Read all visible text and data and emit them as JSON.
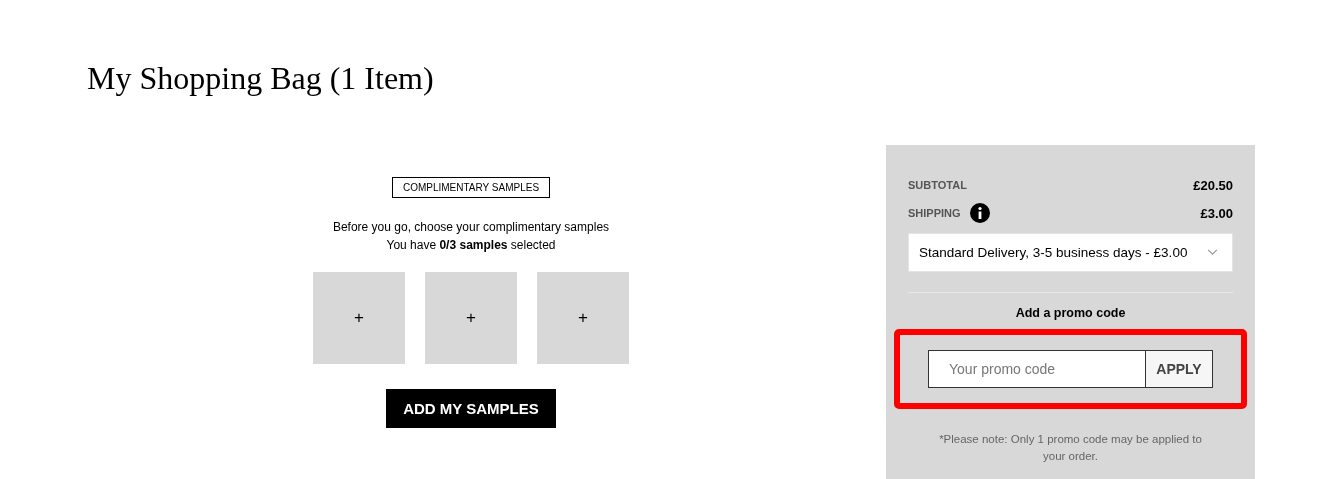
{
  "page_title": "My Shopping Bag (1 Item)",
  "samples": {
    "badge": "COMPLIMENTARY SAMPLES",
    "intro": "Before you go, choose your complimentary samples",
    "count_text": "You have **0/3 samples** selected",
    "slots": [
      {
        "label": "+"
      },
      {
        "label": "+"
      },
      {
        "label": "+"
      }
    ],
    "button": "ADD MY SAMPLES"
  },
  "summary": {
    "rows": [
      {
        "label": "SUBTOTAL",
        "value": "£20.50",
        "info": false
      },
      {
        "label": "SHIPPING",
        "value": "£3.00",
        "info": true
      }
    ],
    "shipping_select": {
      "value": "Standard Delivery, 3-5 business days - £3.00"
    },
    "promo": {
      "heading": "Add a promo code",
      "placeholder": "Your promo code",
      "button": "APPLY",
      "highlighted": true
    },
    "note": "*Please note: Only 1 promo code may be applied to your order."
  }
}
